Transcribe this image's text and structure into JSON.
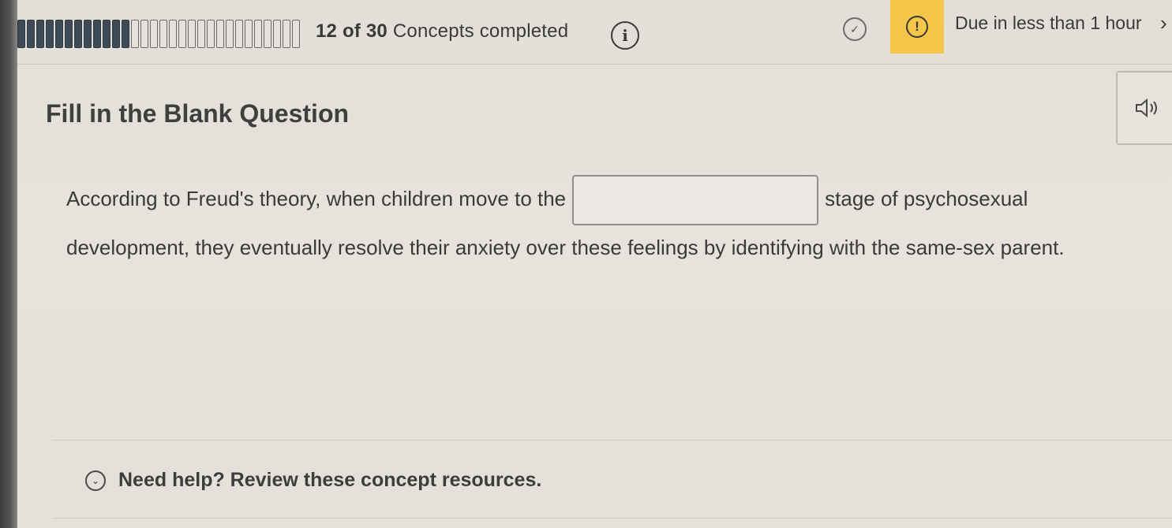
{
  "progress": {
    "completed": 12,
    "total": 30,
    "count_text": "12 of 30",
    "label": "Concepts completed"
  },
  "status": {
    "due_text": "Due in less than 1 hour",
    "due_color": "#f4c64a"
  },
  "icons": {
    "info": "info-icon",
    "check": "check-circle-icon",
    "alert": "alert-icon",
    "chevron": "chevron-right-icon",
    "audio": "speaker-icon",
    "help_toggle": "chevron-down-icon"
  },
  "question": {
    "title": "Fill in the Blank Question",
    "text_before": "According to Freud's theory, when children move to the",
    "blank_value": "",
    "text_after": "stage of psychosexual development, they eventually resolve their anxiety over these feelings by identifying with the same-sex parent."
  },
  "help": {
    "label": "Need help? Review these concept resources."
  }
}
